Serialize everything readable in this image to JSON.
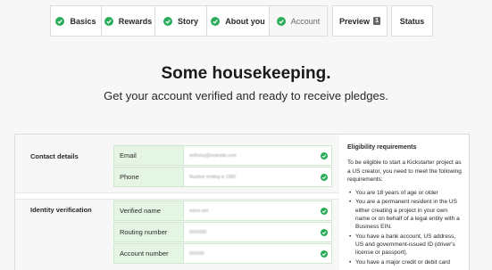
{
  "tabs": [
    {
      "label": "Basics",
      "checked": true,
      "active": false
    },
    {
      "label": "Rewards",
      "checked": true,
      "active": false
    },
    {
      "label": "Story",
      "checked": true,
      "active": false
    },
    {
      "label": "About you",
      "checked": true,
      "active": false
    },
    {
      "label": "Account",
      "checked": true,
      "active": true
    },
    {
      "label": "Preview",
      "badge": "1",
      "checked": false,
      "active": false
    },
    {
      "label": "Status",
      "checked": false,
      "active": false
    }
  ],
  "heading": "Some housekeeping.",
  "subheading": "Get your account verified and ready to receive pledges.",
  "sections": {
    "contact": {
      "label": "Contact details",
      "fields": [
        {
          "label": "Email",
          "value": "anthony@example.com"
        },
        {
          "label": "Phone",
          "value": "Number ending in 1580"
        }
      ]
    },
    "identity": {
      "label": "Identity verification",
      "fields": [
        {
          "label": "Verified name",
          "value": "name ism"
        },
        {
          "label": "Routing number",
          "value": "0000000"
        },
        {
          "label": "Account number",
          "value": "000000"
        }
      ]
    }
  },
  "eligibility": {
    "title": "Eligibility requirements",
    "intro": "To be eligible to start a Kickstarter project as a US creator, you need to meet the following requirements:",
    "items": [
      "You are 18 years of age or older",
      "You are a permanent resident in the US either creating a project in your own name or on behalf of a legal entity with a Business EIN.",
      "You have a bank account, US address, US and government-issued ID (driver's license or passport).",
      "You have a major credit or debit card"
    ]
  },
  "colors": {
    "check_green": "#2bad5b",
    "field_label_bg": "#e5f5e4",
    "page_bg": "#f7f7f7"
  },
  "icons": {
    "check": "check-circle-icon"
  }
}
